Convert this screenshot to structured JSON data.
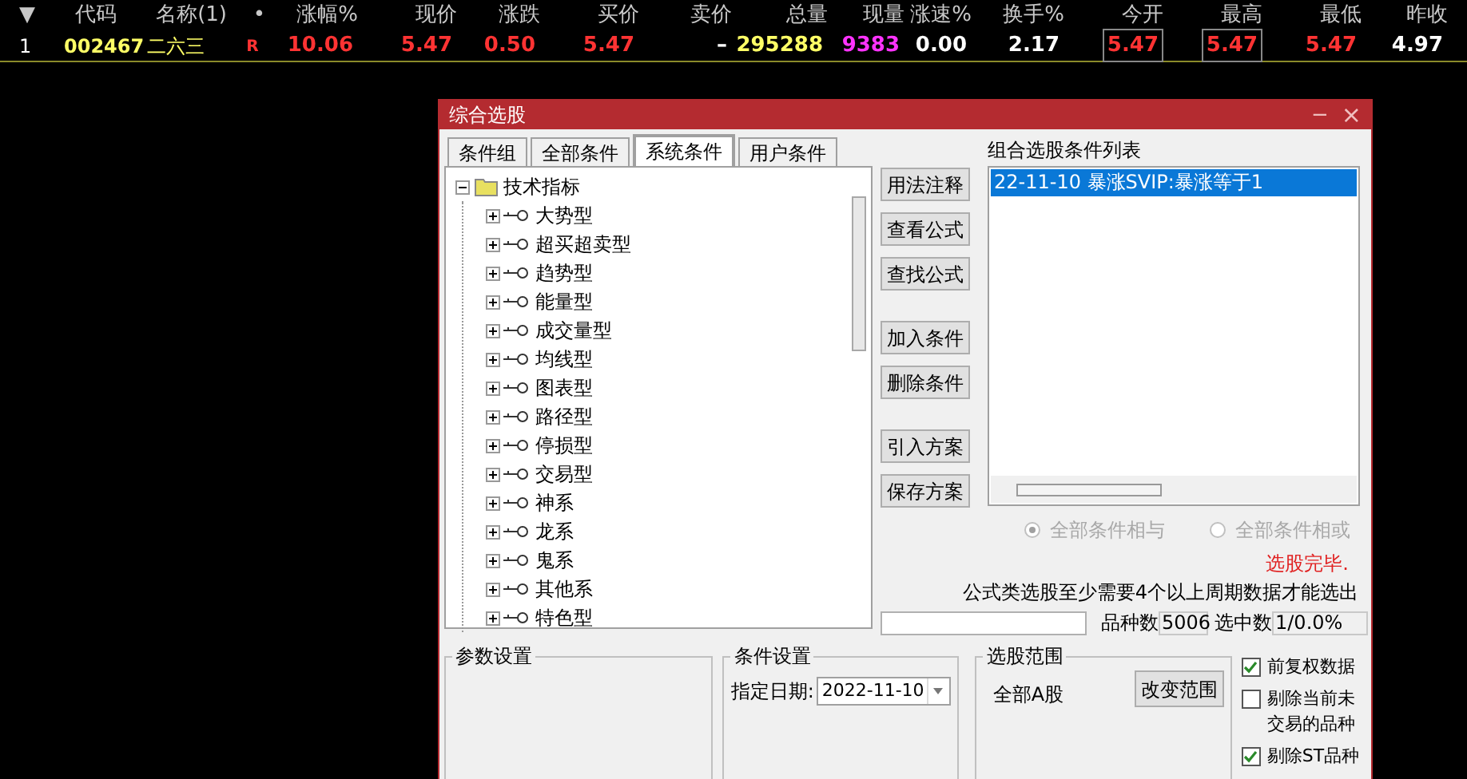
{
  "quote_table": {
    "columns": [
      {
        "label": "▼"
      },
      {
        "label": "代码"
      },
      {
        "label": "名称(1)"
      },
      {
        "label": "•"
      },
      {
        "label": "涨幅%"
      },
      {
        "label": "现价"
      },
      {
        "label": "涨跌"
      },
      {
        "label": "买价"
      },
      {
        "label": "卖价"
      },
      {
        "label": "总量"
      },
      {
        "label": "现量"
      },
      {
        "label": "涨速%"
      },
      {
        "label": "换手%"
      },
      {
        "label": "今开"
      },
      {
        "label": "最高"
      },
      {
        "label": "最低"
      },
      {
        "label": "昨收"
      }
    ],
    "rows": [
      {
        "cells": [
          {
            "text": "1",
            "color": "#ffffff",
            "boxed": false
          },
          {
            "text": "002467",
            "color": "#ffff66",
            "boxed": false
          },
          {
            "text": "二六三",
            "color": "#ffff66",
            "boxed": false
          },
          {
            "text": "R",
            "color": "#ff3333",
            "boxed": false
          },
          {
            "text": "10.06",
            "color": "#ff3333",
            "boxed": false
          },
          {
            "text": "5.47",
            "color": "#ff3333",
            "boxed": false
          },
          {
            "text": "0.50",
            "color": "#ff3333",
            "boxed": false
          },
          {
            "text": "5.47",
            "color": "#ff3333",
            "boxed": false
          },
          {
            "text": "–",
            "color": "#ffffff",
            "boxed": false
          },
          {
            "text": "295288",
            "color": "#ffff66",
            "boxed": false
          },
          {
            "text": "9383",
            "color": "#ff33ff",
            "boxed": false
          },
          {
            "text": "0.00",
            "color": "#ffffff",
            "boxed": false
          },
          {
            "text": "2.17",
            "color": "#ffffff",
            "boxed": false
          },
          {
            "text": "5.47",
            "color": "#ff3333",
            "boxed": true
          },
          {
            "text": "5.47",
            "color": "#ff3333",
            "boxed": true
          },
          {
            "text": "5.47",
            "color": "#ff3333",
            "boxed": false
          },
          {
            "text": "4.97",
            "color": "#ffffff",
            "boxed": false
          }
        ]
      }
    ]
  },
  "dialog": {
    "title": "综合选股",
    "minimize": "−",
    "close": "×",
    "tabs": [
      {
        "label": "条件组",
        "selected": false
      },
      {
        "label": "全部条件",
        "selected": false
      },
      {
        "label": "系统条件",
        "selected": true
      },
      {
        "label": "用户条件",
        "selected": false
      }
    ],
    "tree": {
      "label": "技术指标",
      "expanded": true,
      "children": [
        {
          "label": "大势型"
        },
        {
          "label": "超买超卖型"
        },
        {
          "label": "趋势型"
        },
        {
          "label": "能量型"
        },
        {
          "label": "成交量型"
        },
        {
          "label": "均线型"
        },
        {
          "label": "图表型"
        },
        {
          "label": "路径型"
        },
        {
          "label": "停损型"
        },
        {
          "label": "交易型"
        },
        {
          "label": "神系"
        },
        {
          "label": "龙系"
        },
        {
          "label": "鬼系"
        },
        {
          "label": "其他系"
        },
        {
          "label": "特色型"
        }
      ]
    },
    "button_groups": [
      [
        {
          "label": "用法注释"
        },
        {
          "label": "查看公式"
        },
        {
          "label": "查找公式"
        }
      ],
      [
        {
          "label": "加入条件"
        },
        {
          "label": "删除条件"
        }
      ],
      [
        {
          "label": "引入方案"
        },
        {
          "label": "保存方案"
        }
      ]
    ],
    "condition_list": {
      "title": "组合选股条件列表",
      "items": [
        {
          "text": "22-11-10 暴涨SVIP:暴涨等于1",
          "selected": true
        }
      ]
    },
    "radios": [
      {
        "label": "全部条件相与",
        "selected": true,
        "disabled": true
      },
      {
        "label": "全部条件相或",
        "selected": false,
        "disabled": true
      }
    ],
    "status": "选股完毕.",
    "note": "公式类选股至少需要4个以上周期数据才能选出",
    "count_label": "品种数",
    "count_value": "5006",
    "selected_label": "选中数",
    "selected_value": "1/0.0%",
    "param_group": {
      "title": "参数设置"
    },
    "condition_group": {
      "title": "条件设置",
      "date_label": "指定日期:",
      "date_value": "2022-11-10"
    },
    "scope_group": {
      "title": "选股范围",
      "scope": "全部A股",
      "button": "改变范围"
    },
    "options": [
      {
        "label": "前复权数据",
        "checked": true
      },
      {
        "label": "剔除当前未交易的品种",
        "checked": false
      },
      {
        "label": "剔除ST品种",
        "checked": true
      }
    ]
  }
}
